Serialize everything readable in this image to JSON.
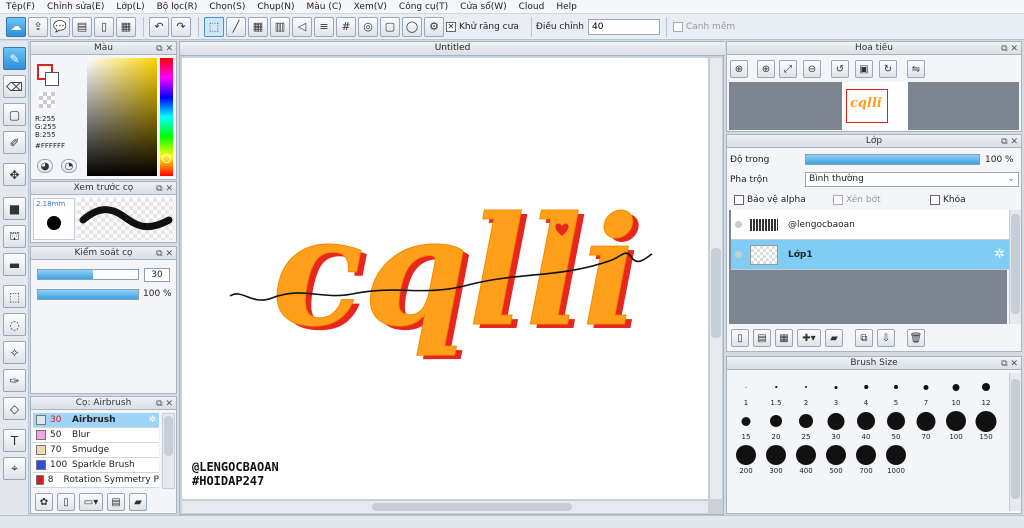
{
  "menu": [
    "Tệp(F)",
    "Chỉnh sửa(E)",
    "Lớp(L)",
    "Bộ lọc(R)",
    "Chọn(S)",
    "Chụp(N)",
    "Màu (C)",
    "Xem(V)",
    "Công cụ(T)",
    "Cửa sổ(W)",
    "Cloud",
    "Help"
  ],
  "toolbar": {
    "antialias_label": "Khử răng cưa",
    "adjust_label": "Điều chỉnh",
    "adjust_value": "40",
    "smooth_label": "Canh mềm"
  },
  "color_panel": {
    "title": "Màu",
    "rgb": [
      "R:255",
      "G:255",
      "B:255"
    ],
    "hex": "#FFFFFF",
    "primary_color": "#e0201a",
    "secondary_color": "#ffffff"
  },
  "brush_preview": {
    "title": "Xem trước cọ",
    "size": "2.18mm"
  },
  "brush_control": {
    "title": "Kiểm soát cọ",
    "size_value": "30",
    "opacity_value": "100 %",
    "size_fill": 0.55,
    "opacity_fill": 1.0
  },
  "brush_list": {
    "title": "Cọ: Airbrush",
    "items": [
      {
        "size": "30",
        "name": "Airbrush",
        "color": "#dfe6ee",
        "selected": true
      },
      {
        "size": "50",
        "name": "Blur",
        "color": "#f2a3e6",
        "selected": false
      },
      {
        "size": "70",
        "name": "Smudge",
        "color": "#f3d9b0",
        "selected": false
      },
      {
        "size": "100",
        "name": "Sparkle Brush",
        "color": "#2b4fd9",
        "selected": false
      },
      {
        "size": "8",
        "name": "Rotation Symmetry P",
        "color": "#d91d1d",
        "selected": false
      }
    ]
  },
  "canvas": {
    "tab_title": "Untitled",
    "artwork_text": "cqlli",
    "signature_line1": "@LENGOCBAOAN",
    "signature_line2": "#HOIDAP247"
  },
  "navigator": {
    "title": "Hoa tiêu",
    "thumb_text": "cqlli"
  },
  "layers": {
    "title": "Lớp",
    "opacity_label": "Độ trong",
    "opacity_value": "100 %",
    "opacity_fill": 1.0,
    "blend_label": "Pha trộn",
    "blend_value": "Bình thường",
    "protect_alpha": "Bảo vệ alpha",
    "clipping": "Xén bớt",
    "lock": "Khóa",
    "items": [
      {
        "name": "@lengocbaoan",
        "selected": false
      },
      {
        "name": "Lớp1",
        "selected": true
      }
    ]
  },
  "brush_size": {
    "title": "Brush Size",
    "sizes": [
      {
        "label": "1",
        "d": 1
      },
      {
        "label": "1.5",
        "d": 1.5
      },
      {
        "label": "2",
        "d": 2
      },
      {
        "label": "3",
        "d": 3
      },
      {
        "label": "4",
        "d": 3.5
      },
      {
        "label": "5",
        "d": 4
      },
      {
        "label": "7",
        "d": 5
      },
      {
        "label": "10",
        "d": 7
      },
      {
        "label": "12",
        "d": 8
      },
      {
        "label": "15",
        "d": 9
      },
      {
        "label": "20",
        "d": 12
      },
      {
        "label": "25",
        "d": 14
      },
      {
        "label": "30",
        "d": 17
      },
      {
        "label": "40",
        "d": 18
      },
      {
        "label": "50",
        "d": 18
      },
      {
        "label": "70",
        "d": 19
      },
      {
        "label": "100",
        "d": 20
      },
      {
        "label": "150",
        "d": 21
      },
      {
        "label": "200",
        "d": 20
      },
      {
        "label": "300",
        "d": 20
      },
      {
        "label": "400",
        "d": 20
      },
      {
        "label": "500",
        "d": 20
      },
      {
        "label": "700",
        "d": 20
      },
      {
        "label": "1000",
        "d": 20
      }
    ]
  }
}
